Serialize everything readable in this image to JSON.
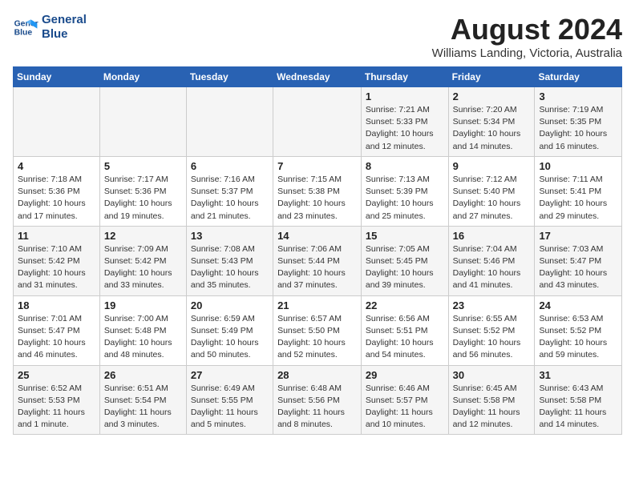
{
  "header": {
    "logo_line1": "General",
    "logo_line2": "Blue",
    "month_year": "August 2024",
    "location": "Williams Landing, Victoria, Australia"
  },
  "weekdays": [
    "Sunday",
    "Monday",
    "Tuesday",
    "Wednesday",
    "Thursday",
    "Friday",
    "Saturday"
  ],
  "weeks": [
    [
      {
        "day": "",
        "info": ""
      },
      {
        "day": "",
        "info": ""
      },
      {
        "day": "",
        "info": ""
      },
      {
        "day": "",
        "info": ""
      },
      {
        "day": "1",
        "info": "Sunrise: 7:21 AM\nSunset: 5:33 PM\nDaylight: 10 hours\nand 12 minutes."
      },
      {
        "day": "2",
        "info": "Sunrise: 7:20 AM\nSunset: 5:34 PM\nDaylight: 10 hours\nand 14 minutes."
      },
      {
        "day": "3",
        "info": "Sunrise: 7:19 AM\nSunset: 5:35 PM\nDaylight: 10 hours\nand 16 minutes."
      }
    ],
    [
      {
        "day": "4",
        "info": "Sunrise: 7:18 AM\nSunset: 5:36 PM\nDaylight: 10 hours\nand 17 minutes."
      },
      {
        "day": "5",
        "info": "Sunrise: 7:17 AM\nSunset: 5:36 PM\nDaylight: 10 hours\nand 19 minutes."
      },
      {
        "day": "6",
        "info": "Sunrise: 7:16 AM\nSunset: 5:37 PM\nDaylight: 10 hours\nand 21 minutes."
      },
      {
        "day": "7",
        "info": "Sunrise: 7:15 AM\nSunset: 5:38 PM\nDaylight: 10 hours\nand 23 minutes."
      },
      {
        "day": "8",
        "info": "Sunrise: 7:13 AM\nSunset: 5:39 PM\nDaylight: 10 hours\nand 25 minutes."
      },
      {
        "day": "9",
        "info": "Sunrise: 7:12 AM\nSunset: 5:40 PM\nDaylight: 10 hours\nand 27 minutes."
      },
      {
        "day": "10",
        "info": "Sunrise: 7:11 AM\nSunset: 5:41 PM\nDaylight: 10 hours\nand 29 minutes."
      }
    ],
    [
      {
        "day": "11",
        "info": "Sunrise: 7:10 AM\nSunset: 5:42 PM\nDaylight: 10 hours\nand 31 minutes."
      },
      {
        "day": "12",
        "info": "Sunrise: 7:09 AM\nSunset: 5:42 PM\nDaylight: 10 hours\nand 33 minutes."
      },
      {
        "day": "13",
        "info": "Sunrise: 7:08 AM\nSunset: 5:43 PM\nDaylight: 10 hours\nand 35 minutes."
      },
      {
        "day": "14",
        "info": "Sunrise: 7:06 AM\nSunset: 5:44 PM\nDaylight: 10 hours\nand 37 minutes."
      },
      {
        "day": "15",
        "info": "Sunrise: 7:05 AM\nSunset: 5:45 PM\nDaylight: 10 hours\nand 39 minutes."
      },
      {
        "day": "16",
        "info": "Sunrise: 7:04 AM\nSunset: 5:46 PM\nDaylight: 10 hours\nand 41 minutes."
      },
      {
        "day": "17",
        "info": "Sunrise: 7:03 AM\nSunset: 5:47 PM\nDaylight: 10 hours\nand 43 minutes."
      }
    ],
    [
      {
        "day": "18",
        "info": "Sunrise: 7:01 AM\nSunset: 5:47 PM\nDaylight: 10 hours\nand 46 minutes."
      },
      {
        "day": "19",
        "info": "Sunrise: 7:00 AM\nSunset: 5:48 PM\nDaylight: 10 hours\nand 48 minutes."
      },
      {
        "day": "20",
        "info": "Sunrise: 6:59 AM\nSunset: 5:49 PM\nDaylight: 10 hours\nand 50 minutes."
      },
      {
        "day": "21",
        "info": "Sunrise: 6:57 AM\nSunset: 5:50 PM\nDaylight: 10 hours\nand 52 minutes."
      },
      {
        "day": "22",
        "info": "Sunrise: 6:56 AM\nSunset: 5:51 PM\nDaylight: 10 hours\nand 54 minutes."
      },
      {
        "day": "23",
        "info": "Sunrise: 6:55 AM\nSunset: 5:52 PM\nDaylight: 10 hours\nand 56 minutes."
      },
      {
        "day": "24",
        "info": "Sunrise: 6:53 AM\nSunset: 5:52 PM\nDaylight: 10 hours\nand 59 minutes."
      }
    ],
    [
      {
        "day": "25",
        "info": "Sunrise: 6:52 AM\nSunset: 5:53 PM\nDaylight: 11 hours\nand 1 minute."
      },
      {
        "day": "26",
        "info": "Sunrise: 6:51 AM\nSunset: 5:54 PM\nDaylight: 11 hours\nand 3 minutes."
      },
      {
        "day": "27",
        "info": "Sunrise: 6:49 AM\nSunset: 5:55 PM\nDaylight: 11 hours\nand 5 minutes."
      },
      {
        "day": "28",
        "info": "Sunrise: 6:48 AM\nSunset: 5:56 PM\nDaylight: 11 hours\nand 8 minutes."
      },
      {
        "day": "29",
        "info": "Sunrise: 6:46 AM\nSunset: 5:57 PM\nDaylight: 11 hours\nand 10 minutes."
      },
      {
        "day": "30",
        "info": "Sunrise: 6:45 AM\nSunset: 5:58 PM\nDaylight: 11 hours\nand 12 minutes."
      },
      {
        "day": "31",
        "info": "Sunrise: 6:43 AM\nSunset: 5:58 PM\nDaylight: 11 hours\nand 14 minutes."
      }
    ]
  ]
}
